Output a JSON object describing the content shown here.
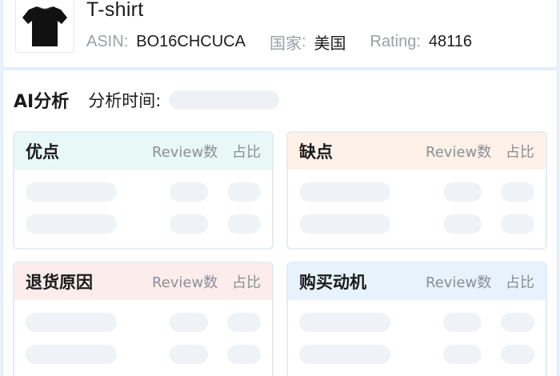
{
  "product": {
    "title": "T-shirt",
    "image_icon": "tshirt-icon",
    "asin_label": "ASIN",
    "asin_value": "BO16CHCUCA",
    "country_label": "国家",
    "country_value": "美国",
    "rating_label": "Rating",
    "rating_value": "48116",
    "colon": ":"
  },
  "analysis": {
    "title": "AI分析",
    "time_label": "分析时间:",
    "time_value": ""
  },
  "panels": [
    {
      "title": "优点",
      "col_review": "Review数",
      "col_ratio": "占比",
      "header_color": "#e7f8f6"
    },
    {
      "title": "缺点",
      "col_review": "Review数",
      "col_ratio": "占比",
      "header_color": "#fdf1e8"
    },
    {
      "title": "退货原因",
      "col_review": "Review数",
      "col_ratio": "占比",
      "header_color": "#fdecec"
    },
    {
      "title": "购买动机",
      "col_review": "Review数",
      "col_ratio": "占比",
      "header_color": "#e7f2fd"
    }
  ],
  "colors": {
    "background": "#e8f2fa",
    "skeleton": "#eff2f6",
    "muted_text": "#9aa0a6"
  }
}
